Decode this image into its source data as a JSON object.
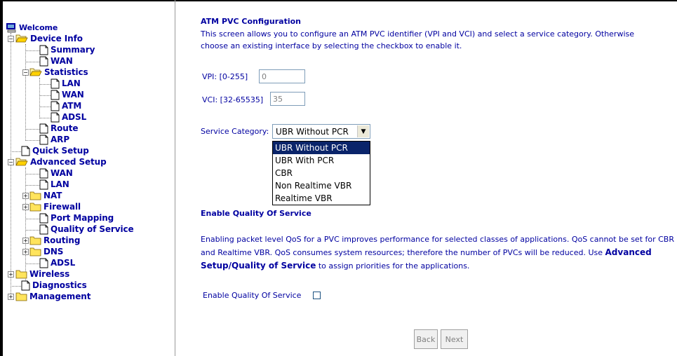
{
  "tree": {
    "welcome": "Welcome",
    "device_info": "Device Info",
    "summary": "Summary",
    "wan": "WAN",
    "statistics": "Statistics",
    "stat_lan": "LAN",
    "stat_wan": "WAN",
    "stat_atm": "ATM",
    "stat_adsl": "ADSL",
    "route": "Route",
    "arp": "ARP",
    "quick_setup": "Quick Setup",
    "advanced_setup": "Advanced Setup",
    "adv_wan": "WAN",
    "adv_lan": "LAN",
    "nat": "NAT",
    "firewall": "Firewall",
    "port_mapping": "Port Mapping",
    "quality_of_service": "Quality of Service",
    "routing": "Routing",
    "dns": "DNS",
    "adv_adsl": "ADSL",
    "wireless": "Wireless",
    "diagnostics": "Diagnostics",
    "management": "Management"
  },
  "main": {
    "title": "ATM PVC Configuration",
    "description": "This screen allows you to configure an ATM PVC identifier (VPI and VCI) and select a service category. Otherwise choose an existing interface by selecting the checkbox to enable it.",
    "vpi_label": "VPI: [0-255]",
    "vpi_value": "0",
    "vci_label": "VCI: [32-65535]",
    "vci_value": "35",
    "service_category_label": "Service Category:",
    "service_category_selected": "UBR Without PCR",
    "service_category_options": [
      "UBR Without PCR",
      "UBR With PCR",
      "CBR",
      "Non Realtime VBR",
      "Realtime VBR"
    ],
    "qos_heading": "Enable Quality Of Service",
    "qos_text_before": "Enabling packet level QoS for a PVC improves performance for selected classes of applications.  QoS cannot be set for CBR and Realtime VBR.  QoS consumes system resources; therefore the number of PVCs will be reduced. Use ",
    "qos_link": "Advanced Setup/Quality of Service",
    "qos_text_after": " to assign priorities for the applications.",
    "qos_checkbox_label": "Enable Quality Of Service",
    "back_label": "Back",
    "next_label": "Next"
  },
  "colors": {
    "text": "#0000a0",
    "selection": "#0a246a"
  },
  "icons": {
    "welcome": "computer-icon",
    "open_folder": "open-folder-icon",
    "folder": "folder-icon",
    "page": "page-icon"
  }
}
